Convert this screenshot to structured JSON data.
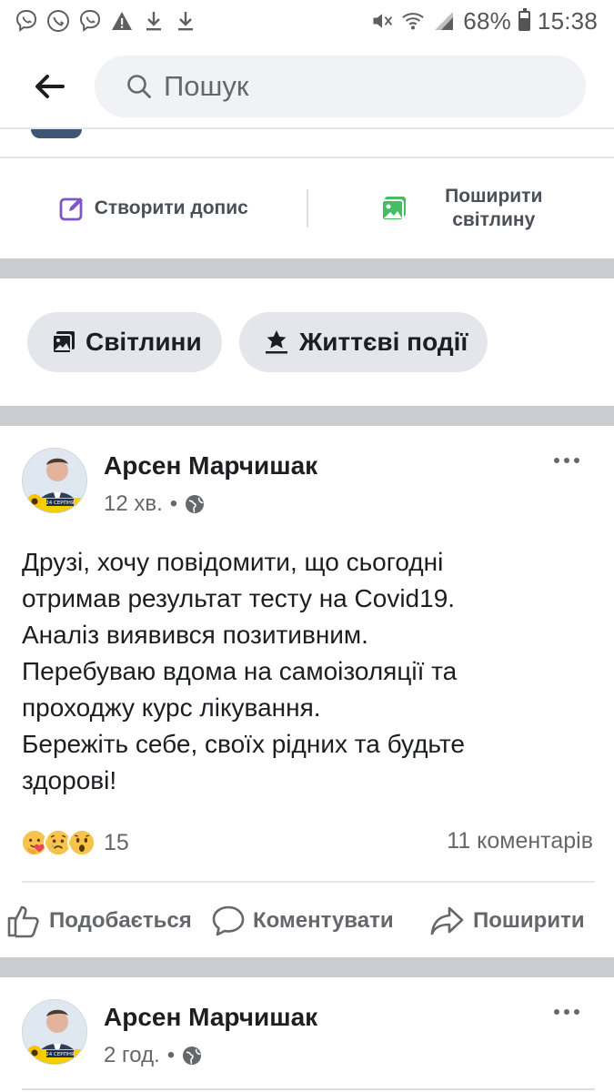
{
  "status_bar": {
    "battery": "68%",
    "time": "15:38",
    "left_icons": [
      "viber-icon",
      "phone-call-icon",
      "viber-icon",
      "warning-icon",
      "download-icon",
      "download-icon"
    ],
    "right_icons": [
      "mute-icon",
      "wifi-icon",
      "signal-icon",
      "battery-icon"
    ]
  },
  "search": {
    "placeholder": "Пошук"
  },
  "actions": {
    "create_post": "Створити допис",
    "share_photo_line1": "Поширити",
    "share_photo_line2": "світлину"
  },
  "chips": {
    "photos": "Світлини",
    "life_events": "Життєві події"
  },
  "posts": [
    {
      "author": "Арсен Марчишак",
      "time": "12 хв.",
      "privacy_icon": "globe-icon",
      "text_lines": [
        "Друзі, хочу повідомити, що сьогодні",
        "отримав результат тесту на Covid19.",
        "Аналіз виявився позитивним.",
        "Перебуваю вдома на самоізоляції та",
        "проходжу курс лікування.",
        "Бережіть себе, своїх рідних та будьте",
        "здорові!"
      ],
      "reactions": [
        "care-reaction",
        "sad-reaction",
        "wow-reaction"
      ],
      "reaction_count": "15",
      "comment_count": "11 коментарів",
      "buttons": {
        "like": "Подобається",
        "comment": "Коментувати",
        "share": "Поширити"
      },
      "avatar_badge": "24 СЕРПНЯ"
    },
    {
      "author": "Арсен Марчишак",
      "time": "2 год.",
      "privacy_icon": "globe-icon",
      "avatar_badge": "24 СЕРПНЯ"
    }
  ],
  "colors": {
    "accent_purple": "#7e57c2",
    "accent_green": "#45bd62",
    "separator_gray": "#c9ccd1",
    "secondary_text": "#65676b"
  }
}
